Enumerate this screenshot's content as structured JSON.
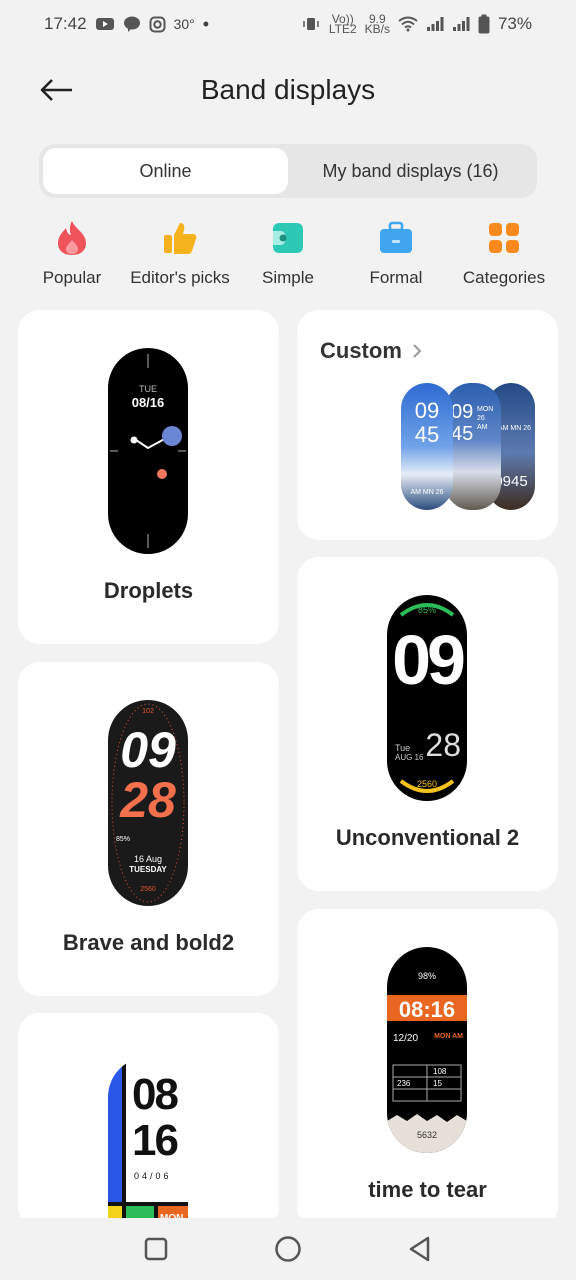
{
  "status_bar": {
    "time": "17:42",
    "temp": "30°",
    "dot": "•",
    "network_speed_top": "9.9",
    "network_speed_bottom": "KB/s",
    "volte_top": "Vo))",
    "volte_bottom": "LTE2",
    "battery": "73%"
  },
  "header": {
    "title": "Band displays",
    "back_icon": "back-arrow-icon"
  },
  "tabs": [
    {
      "label": "Online",
      "active": true
    },
    {
      "label": "My band displays (16)",
      "active": false
    }
  ],
  "categories": [
    {
      "label": "Popular",
      "icon": "flame-icon",
      "color": "#f0545a"
    },
    {
      "label": "Editor's picks",
      "icon": "thumbs-up-icon",
      "color": "#f6b21c"
    },
    {
      "label": "Simple",
      "icon": "simple-icon",
      "color": "#2ec9b4"
    },
    {
      "label": "Formal",
      "icon": "briefcase-icon",
      "color": "#3ea5ee"
    },
    {
      "label": "Categories",
      "icon": "grid-icon",
      "color": "#fb8a1e"
    }
  ],
  "cards": {
    "droplets": {
      "title": "Droplets",
      "day": "TUE",
      "date": "08/16"
    },
    "custom": {
      "title": "Custom",
      "face1_time": "09\n45",
      "face1_sub": "AM MN 26",
      "face2_time": "09\n45",
      "face2_side": "MON\n26\nAM",
      "face3_top": "AM MN 26",
      "face3_time": "0945"
    },
    "unconventional": {
      "title": "Unconventional 2",
      "battery": "85%",
      "hour": "09",
      "day": "Tue",
      "date": "AUG 16",
      "minute": "28",
      "steps": "2560"
    },
    "brave": {
      "title": "Brave and bold2",
      "top_num": "102",
      "hour": "09",
      "minute": "28",
      "battery": "85%",
      "date": "16 Aug",
      "weekday": "TUESDAY",
      "steps": "2560"
    },
    "tear": {
      "title": "time to tear",
      "battery": "98%",
      "time": "08:16",
      "date": "12/20",
      "mon": "MON AM",
      "val1": "108",
      "val2": "236",
      "val3": "15",
      "steps": "5632"
    },
    "fourth": {
      "hour": "08",
      "minute": "16",
      "date": "04/06",
      "day": "MON"
    }
  },
  "nav": {
    "recents": "square-icon",
    "home": "circle-icon",
    "back": "triangle-back-icon"
  }
}
